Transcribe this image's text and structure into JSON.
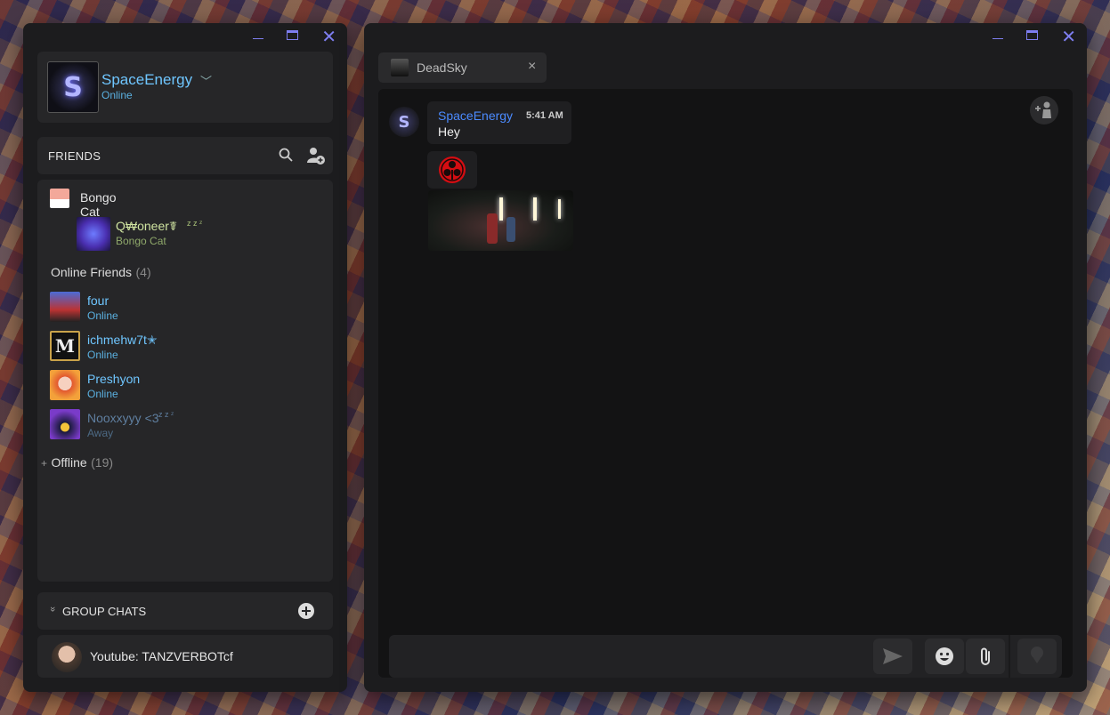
{
  "friends_window": {
    "profile": {
      "name": "SpaceEnergy",
      "status": "Online",
      "logo_letter": "S"
    },
    "friends_header": {
      "title": "FRIENDS"
    },
    "favorite": {
      "group_label": "Bongo Cat",
      "member": {
        "name": "Q₩oneer☤",
        "sleep": "z z ᶻ",
        "sub": "Bongo Cat"
      }
    },
    "online_section": {
      "label": "Online Friends",
      "count": "(4)"
    },
    "online_friends": [
      {
        "name": "four",
        "status": "Online"
      },
      {
        "name": "ichmehw7t✭",
        "status": "Online"
      },
      {
        "name": "Preshyon",
        "status": "Online"
      },
      {
        "name": "Nooxxyyy <3",
        "sleep": "z z ᶻ",
        "status": "Away"
      }
    ],
    "offline_section": {
      "plus": "+",
      "label": "Offline",
      "count": "(19)"
    },
    "group_chats": {
      "chevron": "»",
      "title": "GROUP CHATS",
      "items": [
        {
          "name": "Youtube: TANZVERBOTcf"
        }
      ]
    }
  },
  "chat_window": {
    "tab": {
      "name": "DeadSky",
      "close": "×"
    },
    "messages": [
      {
        "sender": "SpaceEnergy",
        "time": "5:41 AM",
        "text": "Hey"
      }
    ]
  },
  "colors": {
    "accent": "#7e7ef0",
    "name_blue": "#6fc6ff",
    "online": "#5ab0e0",
    "away": "#5f7fa0"
  }
}
